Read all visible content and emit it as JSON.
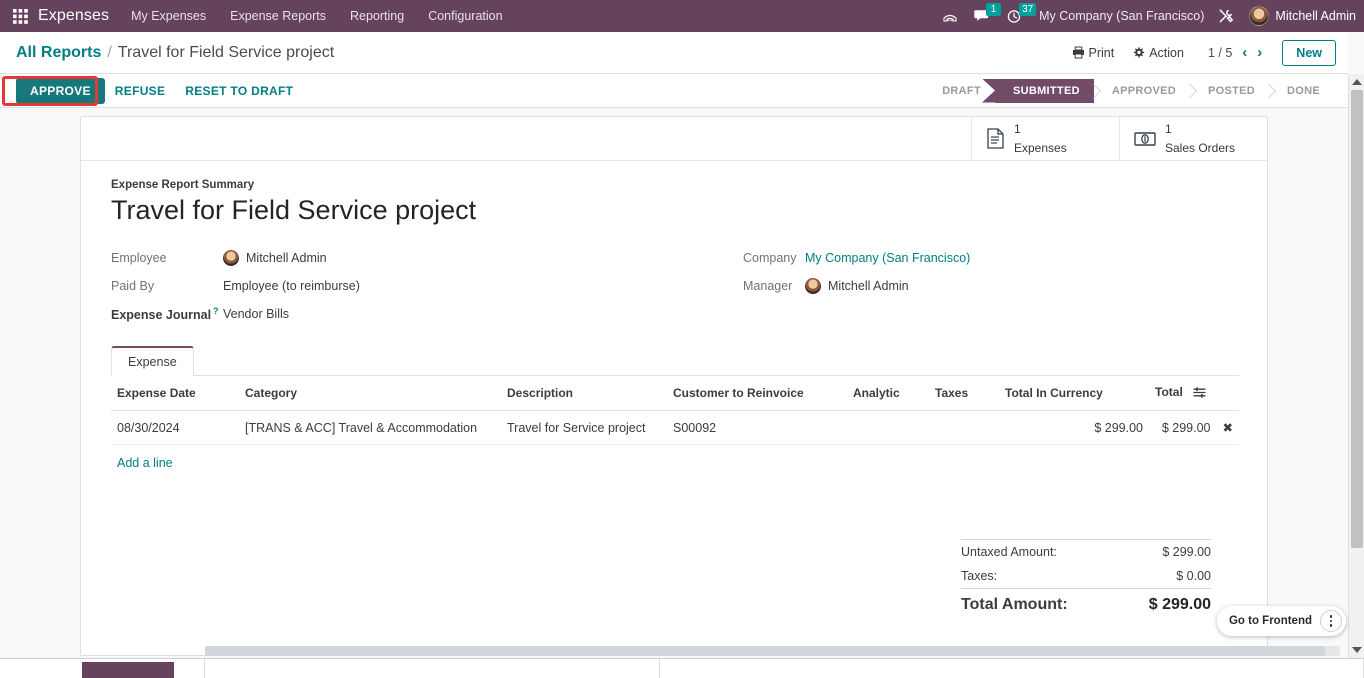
{
  "navbar": {
    "apps_icon": "apps-grid-icon",
    "brand": "Expenses",
    "menu": [
      {
        "label": "My Expenses"
      },
      {
        "label": "Expense Reports"
      },
      {
        "label": "Reporting"
      },
      {
        "label": "Configuration"
      }
    ],
    "phone_icon": "phone-keypad-icon",
    "messages_icon": "chat-bubble-icon",
    "messages_count": "1",
    "activities_icon": "clock-icon",
    "activities_count": "37",
    "company": "My Company (San Francisco)",
    "tools_icon": "tools-icon",
    "user_avatar": "user-avatar",
    "user_name": "Mitchell Admin",
    "badge_color": "#00a09d",
    "bg_color": "#65435c"
  },
  "control_panel": {
    "breadcrumb_root": "All Reports",
    "breadcrumb_separator": "/",
    "breadcrumb_current": "Travel for Field Service project",
    "print_icon": "printer-icon",
    "print_label": "Print",
    "action_icon": "gear-icon",
    "action_label": "Action",
    "pager": "1 / 5",
    "prev_icon": "chevron-left-icon",
    "next_icon": "chevron-right-icon",
    "new_label": "New"
  },
  "actions": {
    "approve_label": "APPROVE",
    "refuse_label": "REFUSE",
    "reset_label": "RESET TO DRAFT",
    "approve_color": "#17787c",
    "highlight_color": "#e53935"
  },
  "statusbar": {
    "stages": [
      {
        "label": "DRAFT",
        "active": false
      },
      {
        "label": "SUBMITTED",
        "active": true
      },
      {
        "label": "APPROVED",
        "active": false
      },
      {
        "label": "POSTED",
        "active": false
      },
      {
        "label": "DONE",
        "active": false
      }
    ],
    "active_color": "#714b67"
  },
  "smart_buttons": [
    {
      "icon": "document-icon",
      "count": "1",
      "label": "Expenses"
    },
    {
      "icon": "banknote-icon",
      "count": "1",
      "label": "Sales Orders"
    }
  ],
  "form": {
    "summary_label": "Expense Report Summary",
    "title": "Travel for Field Service project",
    "left_fields": [
      {
        "label": "Employee",
        "value": "Mitchell Admin",
        "avatar": true,
        "link": false,
        "bold": false,
        "help": false
      },
      {
        "label": "Paid By",
        "value": "Employee (to reimburse)",
        "avatar": false,
        "link": false,
        "bold": false,
        "help": false
      },
      {
        "label": "Expense Journal",
        "value": "Vendor Bills",
        "avatar": false,
        "link": false,
        "bold": true,
        "help": true
      }
    ],
    "right_fields": [
      {
        "label": "Company",
        "value": "My Company (San Francisco)",
        "avatar": false,
        "link": true
      },
      {
        "label": "Manager",
        "value": "Mitchell Admin",
        "avatar": true,
        "link": false
      }
    ]
  },
  "notebook": {
    "tab_label": "Expense",
    "columns": [
      "Expense Date",
      "Category",
      "Description",
      "Customer to Reinvoice",
      "Analytic",
      "Taxes",
      "Total In Currency",
      "Total"
    ],
    "optional_columns_icon": "column-settings-icon",
    "rows": [
      {
        "expense_date": "08/30/2024",
        "category": "[TRANS & ACC] Travel & Accommodation",
        "description": "Travel for Service project",
        "customer_to_reinvoice": "S00092",
        "analytic": "",
        "taxes": "",
        "total_in_currency": "$ 299.00",
        "total": "$ 299.00",
        "delete_icon": "delete-row-icon"
      }
    ],
    "add_line_label": "Add a line"
  },
  "totals": {
    "untaxed_label": "Untaxed Amount:",
    "untaxed_value": "$ 299.00",
    "taxes_label": "Taxes:",
    "taxes_value": "$ 0.00",
    "total_label": "Total Amount:",
    "total_value": "$ 299.00"
  },
  "frontend_pill": {
    "label": "Go to Frontend",
    "menu_icon": "kebab-menu-icon"
  },
  "scrollbars": {
    "vertical_up_icon": "scroll-up-arrow-icon",
    "vertical_down_icon": "scroll-down-arrow-icon"
  }
}
